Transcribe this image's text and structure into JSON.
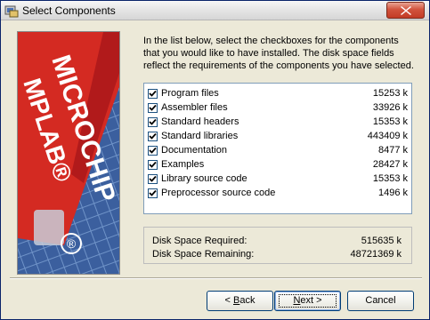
{
  "window": {
    "title": "Select Components",
    "icon": "installer-icon",
    "close_label": "close"
  },
  "artwork": {
    "text_lines": [
      "MICROCHIP",
      "MPLAB®"
    ],
    "registered_mark": "®",
    "colors": {
      "red": "#d42a22",
      "blue": "#3b5f9e",
      "grid": "#6f93c8"
    }
  },
  "description": "In the list below, select the checkboxes for the components that you would like to have installed.  The disk space fields reflect the requirements of the components you have selected.",
  "components": [
    {
      "label": "Program files",
      "size": "15253 k",
      "checked": true
    },
    {
      "label": "Assembler files",
      "size": "33926 k",
      "checked": true
    },
    {
      "label": "Standard headers",
      "size": "15353 k",
      "checked": true
    },
    {
      "label": "Standard libraries",
      "size": "443409 k",
      "checked": true
    },
    {
      "label": "Documentation",
      "size": "8477 k",
      "checked": true
    },
    {
      "label": "Examples",
      "size": "28427 k",
      "checked": true
    },
    {
      "label": "Library source code",
      "size": "15353 k",
      "checked": true
    },
    {
      "label": "Preprocessor source code",
      "size": "1496 k",
      "checked": true
    }
  ],
  "disk": {
    "required_label": "Disk Space Required:",
    "required_value": "515635 k",
    "remaining_label": "Disk Space Remaining:",
    "remaining_value": "48721369 k"
  },
  "buttons": {
    "back_prefix": "< ",
    "back_mnemonic": "B",
    "back_rest": "ack",
    "next_mnemonic": "N",
    "next_rest": "ext >",
    "cancel": "Cancel"
  }
}
